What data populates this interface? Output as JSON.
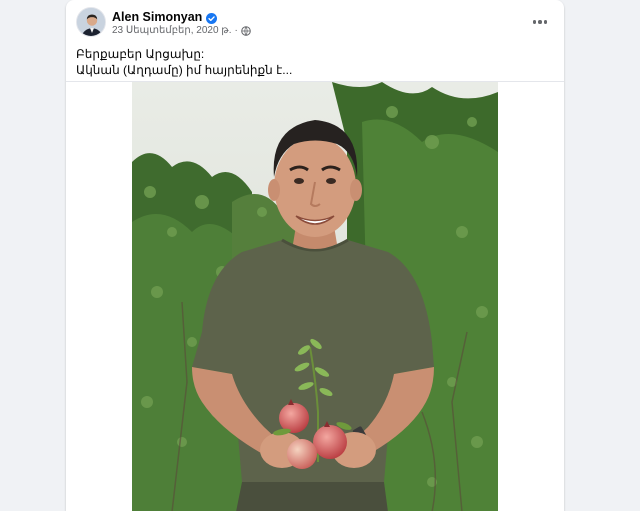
{
  "post": {
    "author_name": "Alen Simonyan",
    "date": "23 Սեպտեմբեր, 2020 թ.",
    "separator": "·",
    "text_line1": "Բերքաբեր Արցախը:",
    "text_line2": "Ակնան (Աղդամը) իմ հայրենիքն է..."
  },
  "icons": {
    "verified": "verified-badge-icon",
    "audience": "globe-icon",
    "more": "more-options-icon"
  },
  "colors": {
    "verified_blue": "#1877f2",
    "background": "#f0f2f5",
    "card": "#ffffff",
    "secondary_text": "#65676b"
  }
}
